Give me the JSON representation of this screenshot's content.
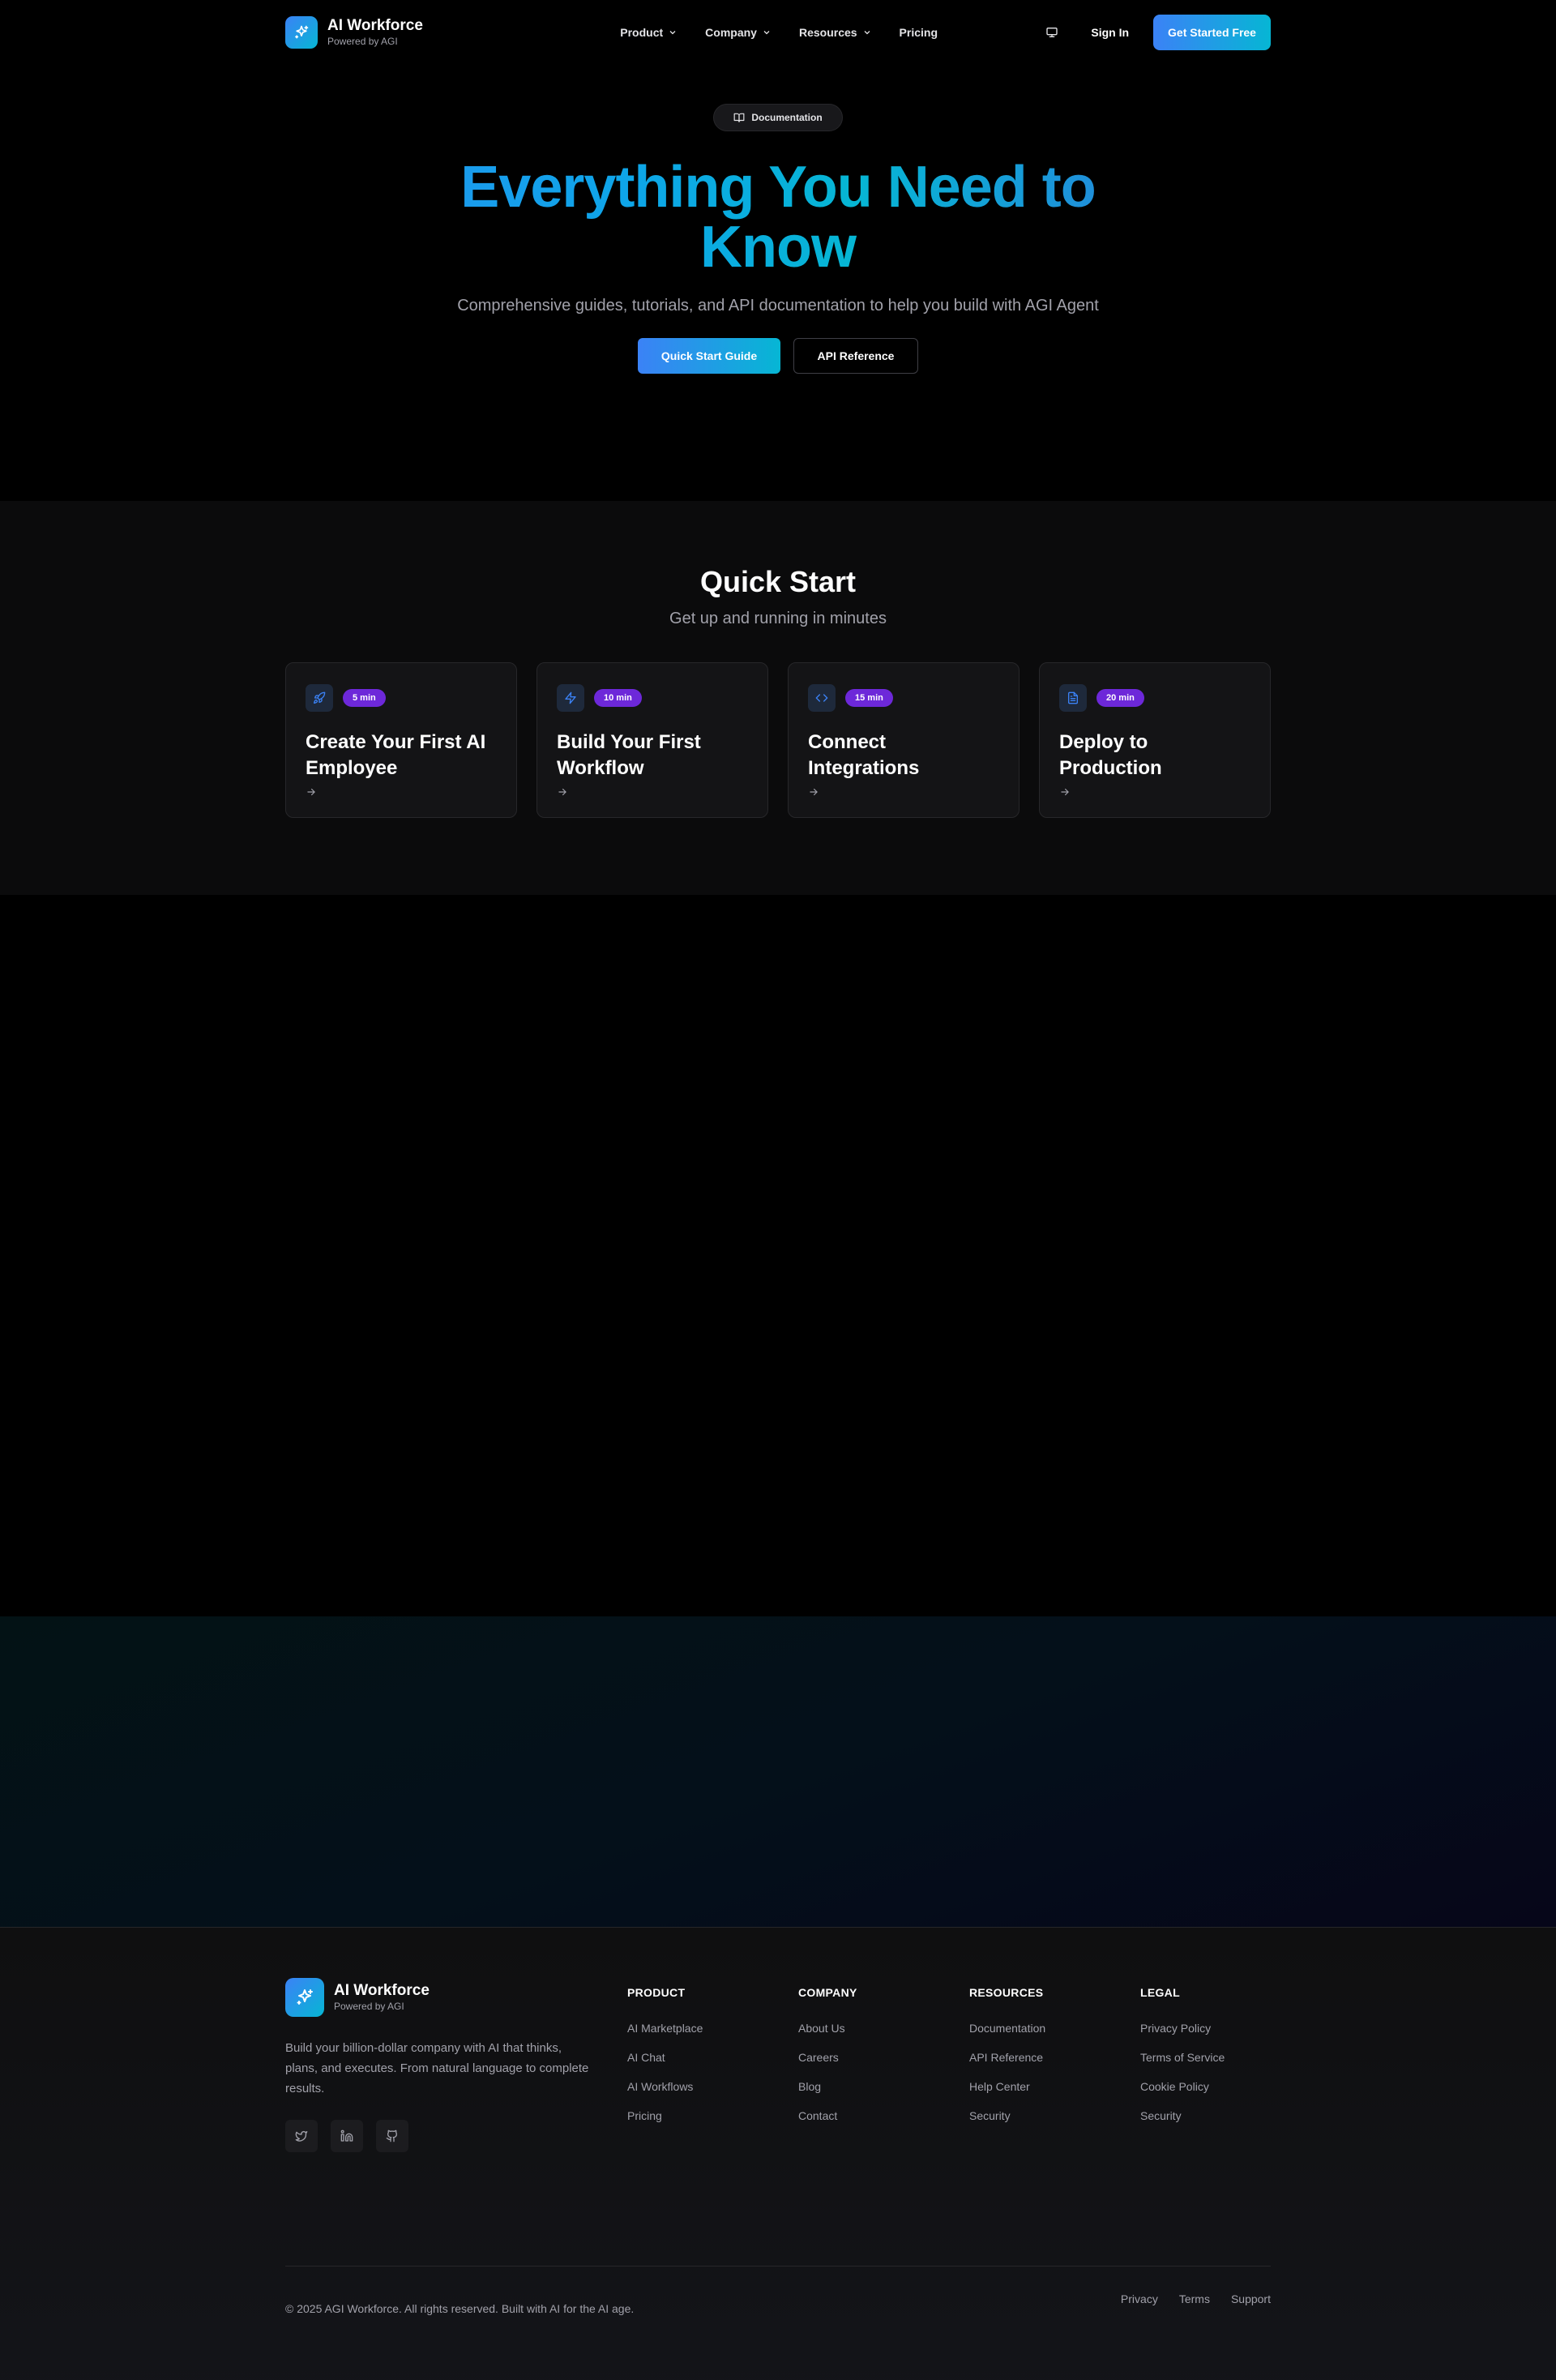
{
  "header": {
    "brand_name": "AI Workforce",
    "brand_sub": "Powered by AGI",
    "menu": [
      {
        "label": "Product",
        "has_dropdown": true
      },
      {
        "label": "Company",
        "has_dropdown": true
      },
      {
        "label": "Resources",
        "has_dropdown": true
      },
      {
        "label": "Pricing",
        "has_dropdown": false
      }
    ],
    "sign_in": "Sign In",
    "cta": "Get Started Free"
  },
  "hero": {
    "badge": "Documentation",
    "title_line1": "Everything You Need to",
    "title_line2": "Know",
    "subtitle": "Comprehensive guides, tutorials, and API documentation to help you build with AGI Agent",
    "primary_button": "Quick Start Guide",
    "secondary_button": "API Reference"
  },
  "quick_start": {
    "title": "Quick Start",
    "subtitle": "Get up and running in minutes",
    "cards": [
      {
        "icon": "rocket-icon",
        "duration": "5 min",
        "title": "Create Your First AI Employee"
      },
      {
        "icon": "zap-icon",
        "duration": "10 min",
        "title": "Build Your First Workflow"
      },
      {
        "icon": "code-icon",
        "duration": "15 min",
        "title": "Connect Integrations"
      },
      {
        "icon": "file-text-icon",
        "duration": "20 min",
        "title": "Deploy to Production"
      }
    ]
  },
  "footer": {
    "brand_name": "AI Workforce",
    "brand_sub": "Powered by AGI",
    "description": "Build your billion-dollar company with AI that thinks, plans, and executes. From natural language to complete results.",
    "socials": [
      "twitter-icon",
      "linkedin-icon",
      "github-icon"
    ],
    "columns": [
      {
        "title": "PRODUCT",
        "links": [
          "AI Marketplace",
          "AI Chat",
          "AI Workflows",
          "Pricing"
        ]
      },
      {
        "title": "COMPANY",
        "links": [
          "About Us",
          "Careers",
          "Blog",
          "Contact"
        ]
      },
      {
        "title": "RESOURCES",
        "links": [
          "Documentation",
          "API Reference",
          "Help Center",
          "Security"
        ]
      },
      {
        "title": "LEGAL",
        "links": [
          "Privacy Policy",
          "Terms of Service",
          "Cookie Policy",
          "Security"
        ]
      }
    ],
    "copyright": "© 2025 AGI Workforce. All rights reserved. Built with AI for the AI age.",
    "bottom_links": [
      "Privacy",
      "Terms",
      "Support"
    ]
  },
  "colors": {
    "accent_blue": "#3b82f6",
    "accent_cyan": "#06b6d4",
    "badge_purple": "#6d28d9",
    "background": "#000000"
  }
}
